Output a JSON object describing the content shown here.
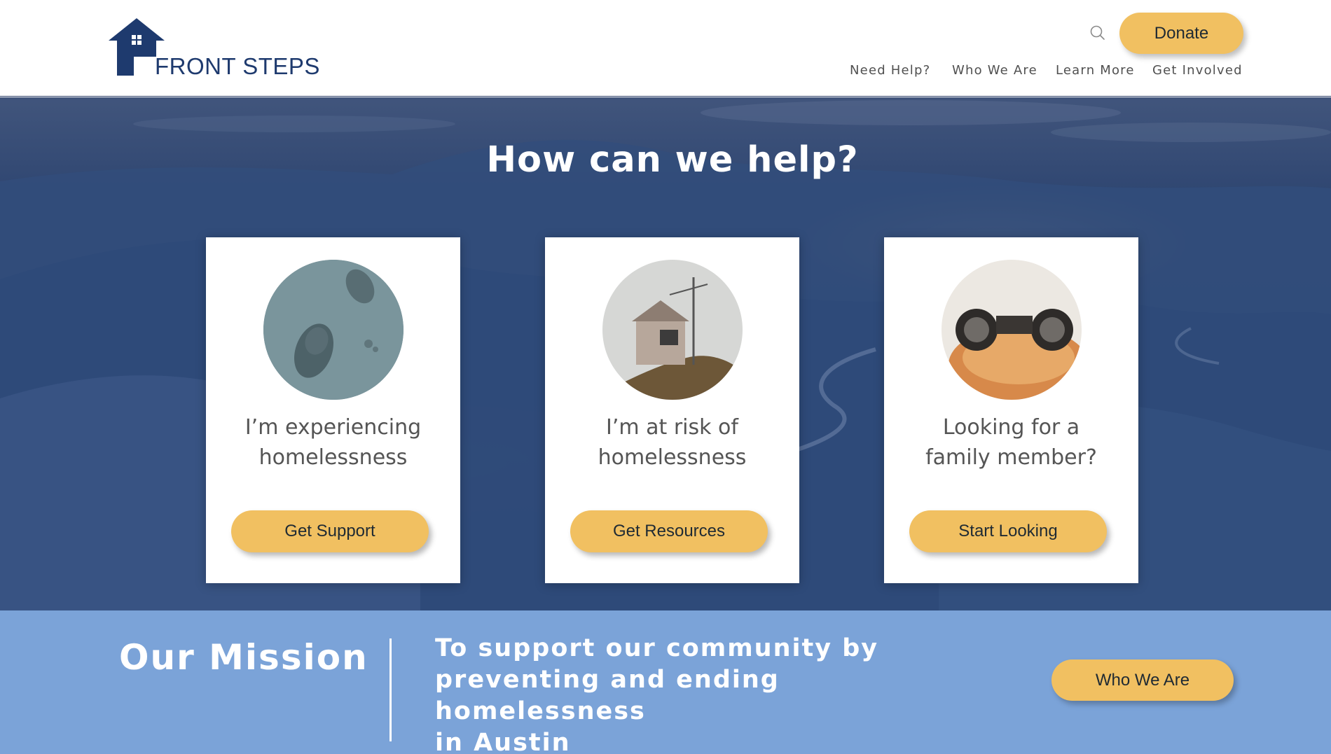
{
  "header": {
    "logo_text": "FRONT STEPS",
    "logo_icon": "house-icon",
    "search_icon": "search-icon",
    "donate_label": "Donate",
    "nav": [
      {
        "label": "Need Help?"
      },
      {
        "label": "Who We Are"
      },
      {
        "label": "Learn More"
      },
      {
        "label": "Get Involved"
      }
    ]
  },
  "hero": {
    "title": "How can we help?",
    "cards": [
      {
        "line1": "I’m experiencing",
        "line2": "homelessness",
        "button": "Get Support",
        "image": "footprints-in-snow"
      },
      {
        "line1": "I’m at risk of",
        "line2": "homelessness",
        "button": "Get Resources",
        "image": "small-cabin-on-hill"
      },
      {
        "line1": "Looking for a",
        "line2": "family member?",
        "button": "Start Looking",
        "image": "binoculars"
      }
    ]
  },
  "mission": {
    "title": "Our Mission",
    "text_lines": [
      "To support our community by",
      "preventing and ending homelessness",
      "in Austin"
    ],
    "button": "Who We Are"
  },
  "colors": {
    "brand_navy": "#1e3a6e",
    "accent_gold": "#f1c061",
    "mission_blue": "#7ba3d8",
    "hero_overlay": "#2c4573"
  }
}
